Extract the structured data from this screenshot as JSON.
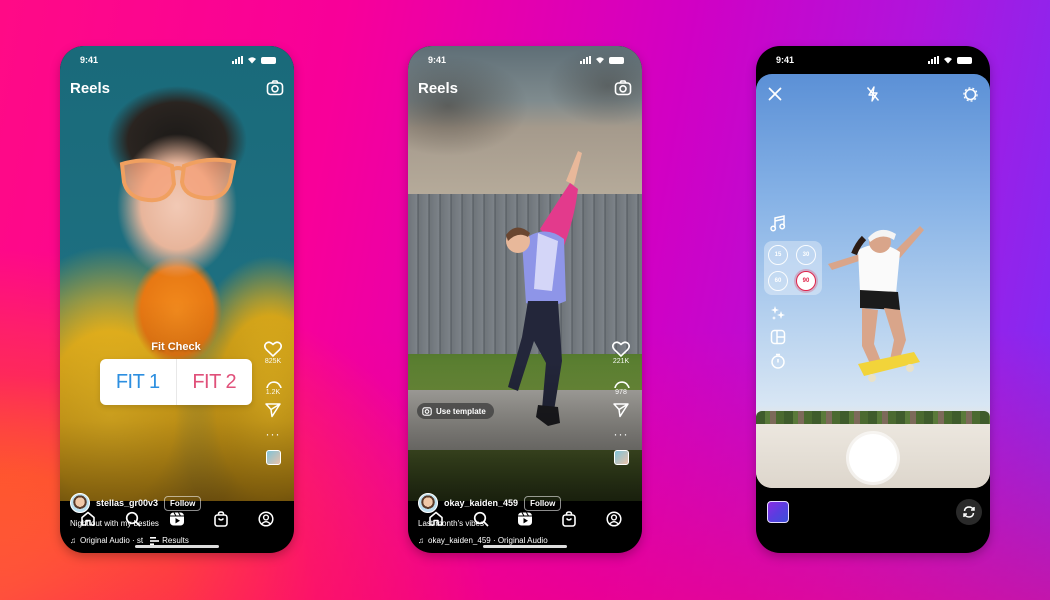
{
  "background": {
    "gradient_colors": [
      "#ff0a86",
      "#d100c4",
      "#7a2ff7",
      "#ffb000"
    ]
  },
  "phones": [
    {
      "id": "reels-fit-check",
      "status_bar": {
        "time": "9:41"
      },
      "header": {
        "title": "Reels",
        "right_icon": "camera-icon"
      },
      "sticker": {
        "title": "Fit Check",
        "options": [
          "FIT 1",
          "FIT 2"
        ],
        "option_colors": [
          "#2d8fe0",
          "#e0507a"
        ]
      },
      "actions": {
        "likes": "825K",
        "comments": "1.2K"
      },
      "post": {
        "username": "stellas_gr00v3",
        "follow_label": "Follow",
        "caption": "Night out with my besties",
        "audio": "Original Audio · st",
        "results_label": "Results"
      },
      "nav": [
        "home-icon",
        "search-icon",
        "reels-icon",
        "shop-icon",
        "profile-icon"
      ]
    },
    {
      "id": "reels-template",
      "status_bar": {
        "time": "9:41"
      },
      "header": {
        "title": "Reels",
        "right_icon": "camera-icon"
      },
      "use_template_label": "Use template",
      "actions": {
        "likes": "221K",
        "comments": "978"
      },
      "post": {
        "username": "okay_kaiden_459",
        "follow_label": "Follow",
        "caption": "Last month's vibes",
        "audio": "okay_kaiden_459 · Original Audio"
      },
      "nav": [
        "home-icon",
        "search-icon",
        "reels-icon",
        "shop-icon",
        "profile-icon"
      ]
    },
    {
      "id": "reels-camera",
      "status_bar": {
        "time": "9:41"
      },
      "top_icons": [
        "close-icon",
        "flash-off-icon",
        "settings-icon"
      ],
      "tools": [
        "music-icon",
        "duration-picker",
        "effects-icon",
        "layout-icon",
        "timer-icon"
      ],
      "durations": [
        "15",
        "30",
        "60",
        "90"
      ],
      "selected_duration": "90",
      "accent_color": "#e0244a"
    }
  ]
}
